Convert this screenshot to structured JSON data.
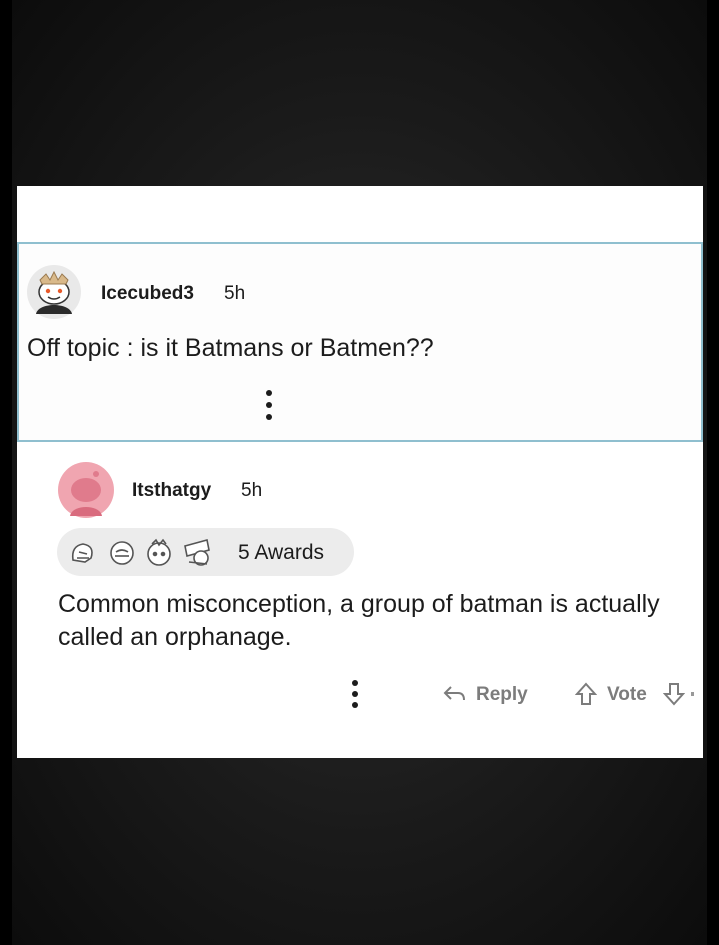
{
  "parent_comment": {
    "username": "Icecubed3",
    "time": "5h",
    "text": "Off topic : is it Batmans or Batmen??"
  },
  "reply_comment": {
    "username": "Itsthatgy",
    "time": "5h",
    "awards_label": "5 Awards",
    "text": "Common misconception, a group of batman is actually called an orphanage."
  },
  "actions": {
    "reply_label": "Reply",
    "vote_label": "Vote"
  },
  "colors": {
    "highlight_border": "#8fbfcf",
    "avatar_pink": "#f0a5b0",
    "action_gray": "#7c7c7c"
  }
}
